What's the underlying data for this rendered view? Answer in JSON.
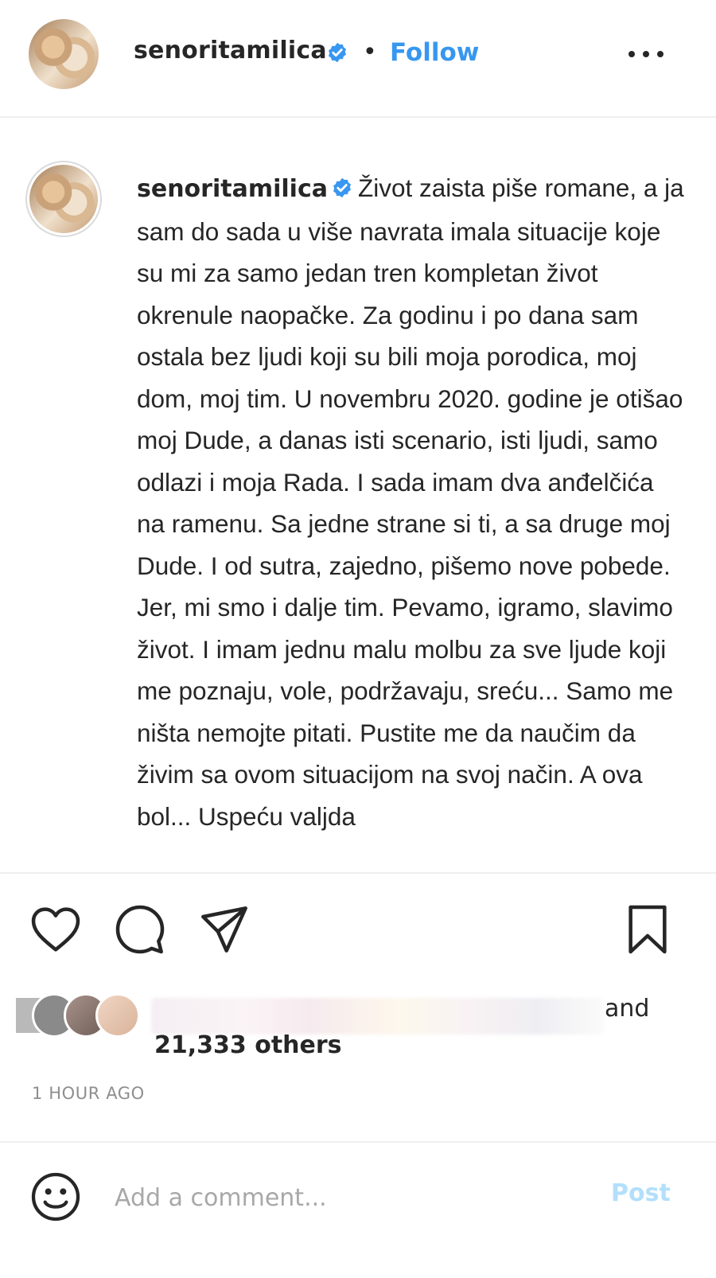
{
  "post_header": {
    "username": "senoritamilica",
    "separator": "•",
    "follow_label": "Follow",
    "more_icon": "more-horizontal-icon"
  },
  "caption": {
    "username": "senoritamilica",
    "text": "Život zaista piše romane, a ja sam do sada u više navrata imala situacije koje su mi za samo jedan tren kompletan život okrenule naopačke. Za godinu i po dana sam ostala bez ljudi koji su bili moja porodica, moj dom, moj tim. U novembru 2020. godine je otišao moj Dude, a danas isti scenario, isti ljudi, samo odlazi i moja Rada. I sada imam dva anđelčića na ramenu. Sa jedne strane si ti, a sa druge moj Dude. I od sutra, zajedno, pišemo nove pobede. Jer, mi smo i dalje tim. Pevamo, igramo, slavimo život. I imam jednu malu molbu za sve ljude koji me poznaju, vole, podržavaju, sreću... Samo me ništa nemojte pitati. Pustite me da naučim da živim sa ovom situacijom na svoj način. A ova bol... Uspeću valjda"
  },
  "actions": {
    "like_icon": "heart-icon",
    "comment_icon": "comment-bubble-icon",
    "share_icon": "paper-plane-icon",
    "save_icon": "bookmark-icon"
  },
  "likes": {
    "and_text": "and",
    "others_text": "21,333 others"
  },
  "timestamp": "1 HOUR AGO",
  "comment_box": {
    "emoji_icon": "smiley-icon",
    "placeholder": "Add a comment...",
    "post_label": "Post"
  },
  "colors": {
    "accent": "#3797ef",
    "verified": "#3897f0",
    "post_disabled": "#b2dffc",
    "muted": "#8e8e8e"
  }
}
